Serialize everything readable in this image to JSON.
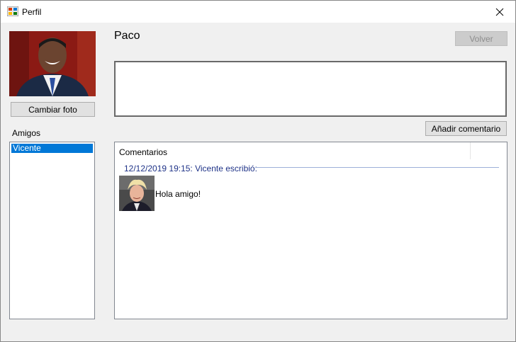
{
  "window": {
    "title": "Perfil",
    "close_glyph": "✕"
  },
  "profile": {
    "name": "Paco",
    "change_photo_label": "Cambiar foto"
  },
  "toolbar": {
    "back_label": "Volver",
    "add_comment_label": "Añadir comentario"
  },
  "friends": {
    "label": "Amigos",
    "items": [
      {
        "label": "Vicente",
        "selected": true
      }
    ]
  },
  "comments": {
    "column_header": "Comentarios",
    "groups": [
      {
        "header": "12/12/2019 19:15: Vicente escribió:",
        "items": [
          {
            "text": "Hola amigo!"
          }
        ]
      }
    ]
  },
  "colors": {
    "selection": "#0078d7",
    "group_header": "#1e3287",
    "window_bg": "#f0f0f0"
  }
}
